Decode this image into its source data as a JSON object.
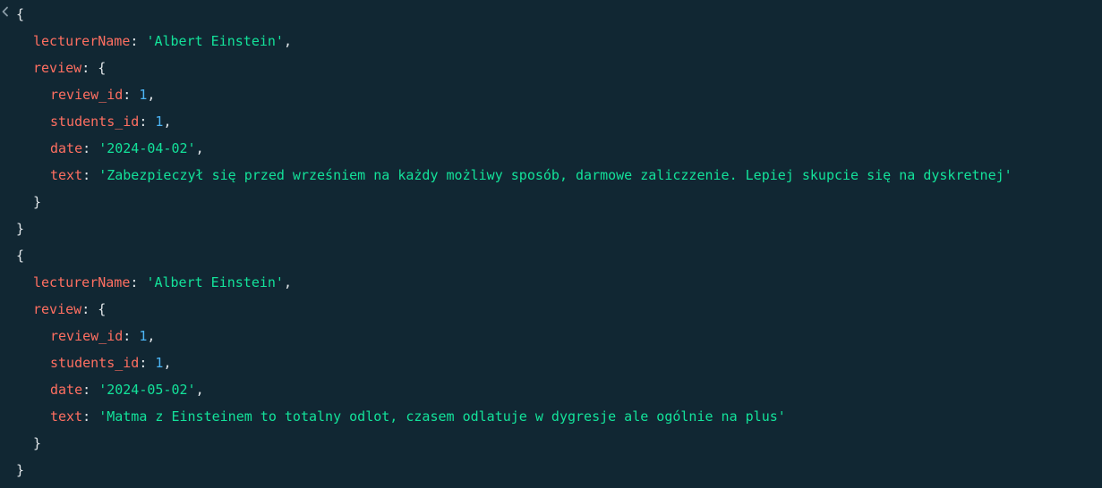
{
  "shell_output": {
    "caret_icon": "chevron-left-icon",
    "colors": {
      "background": "#112733",
      "key": "#FF6F61",
      "string": "#13E29A",
      "number": "#4CB5F5",
      "punctuation": "#E3E8EB"
    },
    "documents": [
      {
        "lecturerName_key": "lecturerName",
        "lecturerName_value": "'Albert Einstein'",
        "review_key": "review",
        "review": {
          "review_id_key": "review_id",
          "review_id_value": "1",
          "students_id_key": "students_id",
          "students_id_value": "1",
          "date_key": "date",
          "date_value": "'2024-04-02'",
          "text_key": "text",
          "text_value": "'Zabezpieczył się przed wrześniem na każdy możliwy sposób, darmowe zaliczzenie. Lepiej skupcie się na dyskretnej'"
        }
      },
      {
        "lecturerName_key": "lecturerName",
        "lecturerName_value": "'Albert Einstein'",
        "review_key": "review",
        "review": {
          "review_id_key": "review_id",
          "review_id_value": "1",
          "students_id_key": "students_id",
          "students_id_value": "1",
          "date_key": "date",
          "date_value": "'2024-05-02'",
          "text_key": "text",
          "text_value": "'Matma z Einsteinem to totalny odlot, czasem odlatuje w dygresje ale ogólnie na plus'"
        }
      }
    ]
  }
}
